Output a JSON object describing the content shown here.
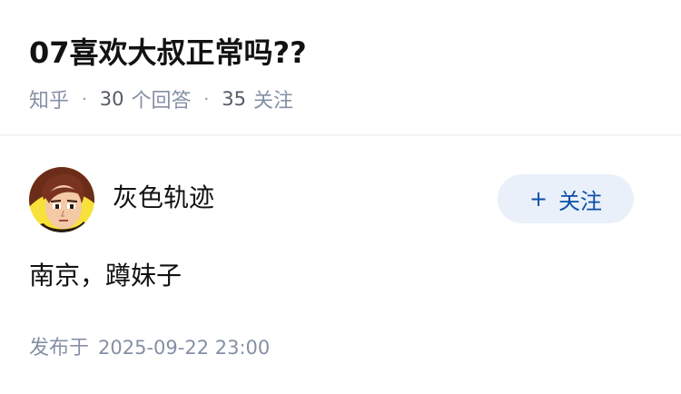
{
  "question": {
    "title": "07喜欢大叔正常吗??",
    "source": "知乎",
    "answer_count": "30",
    "answer_label": "个回答",
    "follow_count": "35",
    "follow_label": "关注"
  },
  "answer": {
    "author_name": "灰色轨迹",
    "follow_button_icon": "plus-icon",
    "follow_button_label": "关注",
    "content": "南京，蹲妹子",
    "published_label": "发布于",
    "published_time": "2025-09-22 23:00"
  },
  "colors": {
    "title": "#121212",
    "meta": "#8590a6",
    "follow_button_bg": "#e9f0f9",
    "follow_button_text": "#0c4fa6"
  }
}
